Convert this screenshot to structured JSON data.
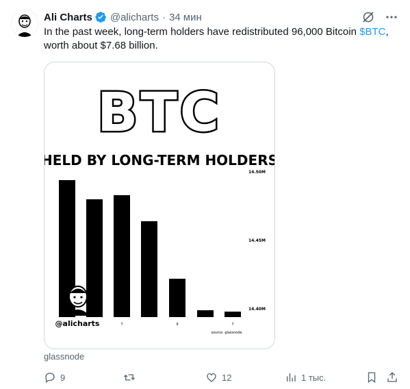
{
  "tweet": {
    "author_name": "Ali Charts",
    "handle": "@alicharts",
    "separator": "·",
    "time": "34 мин",
    "text_before": "In the past week, long-term holders have redistributed 96,000 Bitcoin ",
    "cashtag": "$BTC",
    "text_after": ", worth about $7.68 billion.",
    "media_caption": "glassnode"
  },
  "actions": {
    "replies": "9",
    "retweets": "",
    "likes": "12",
    "views": "1 тыс."
  },
  "icons": [
    "verified-badge-icon",
    "grok-icon",
    "more-icon",
    "reply-icon",
    "retweet-icon",
    "like-icon",
    "views-icon",
    "bookmark-icon",
    "share-icon"
  ],
  "colors": {
    "accent": "#1d9bf0",
    "muted": "#536471",
    "text": "#0f1419"
  },
  "chart_data": {
    "type": "bar",
    "title": "BTC",
    "subtitle": "HELD BY LONG-TERM HOLDERS",
    "ytick_labels": [
      "14.50M",
      "14.45M",
      "14.40M"
    ],
    "ylim": [
      14.4,
      14.5
    ],
    "values": [
      14.498,
      14.484,
      14.487,
      14.468,
      14.426,
      14.403,
      14.402
    ],
    "xtick_labels": [
      "",
      "",
      "7",
      "",
      "9",
      "",
      "7"
    ],
    "watermark": "@alicharts",
    "source": "source: glassnode"
  }
}
